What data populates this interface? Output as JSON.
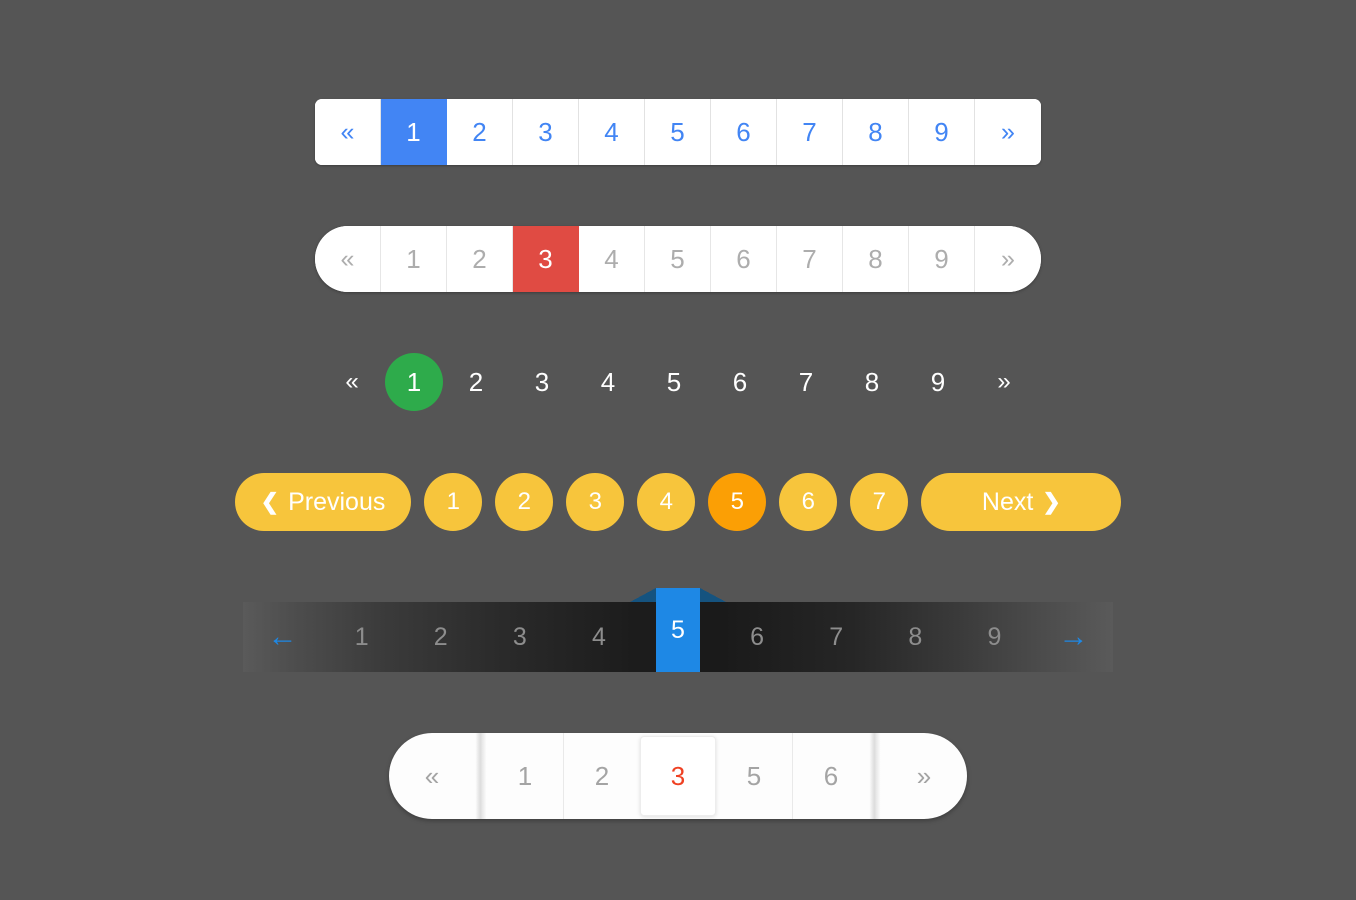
{
  "page": {
    "background_color": "#555555"
  },
  "paginations": [
    {
      "id": "bordered-blue",
      "style": "bordered-square",
      "accent_color": "#4285f4",
      "text_color": "#4285f4",
      "prev_label": "«",
      "next_label": "»",
      "active_page": "1",
      "pages": [
        "1",
        "2",
        "3",
        "4",
        "5",
        "6",
        "7",
        "8",
        "9"
      ]
    },
    {
      "id": "pill-red",
      "style": "rounded-pill",
      "accent_color": "#e04b43",
      "text_color": "#adadad",
      "prev_label": "«",
      "next_label": "»",
      "active_page": "3",
      "pages": [
        "1",
        "2",
        "3",
        "4",
        "5",
        "6",
        "7",
        "8",
        "9"
      ]
    },
    {
      "id": "flat-green",
      "style": "flat-circle",
      "accent_color": "#2eab4b",
      "text_color": "#ffffff",
      "prev_label": "«",
      "next_label": "»",
      "active_page": "1",
      "pages": [
        "1",
        "2",
        "3",
        "4",
        "5",
        "6",
        "7",
        "8",
        "9"
      ]
    },
    {
      "id": "yellow-circles",
      "style": "circle-buttons",
      "accent_color": "#fb9f05",
      "base_color": "#f7c53c",
      "text_color": "#ffffff",
      "prev_label": "Previous",
      "next_label": "Next",
      "prev_icon": "chevron-left-icon",
      "next_icon": "chevron-right-icon",
      "active_page": "5",
      "pages": [
        "1",
        "2",
        "3",
        "4",
        "5",
        "6",
        "7"
      ]
    },
    {
      "id": "dark-gradient",
      "style": "dark-gradient-bar",
      "accent_color": "#1e88e5",
      "text_color": "#8d8d8d",
      "prev_label": "←",
      "next_label": "→",
      "prev_icon": "arrow-left-icon",
      "next_icon": "arrow-right-icon",
      "active_page": "5",
      "pages": [
        "1",
        "2",
        "3",
        "4",
        "5",
        "6",
        "7",
        "8",
        "9"
      ]
    },
    {
      "id": "soft-white",
      "style": "soft-pill-card",
      "accent_color": "#ef4123",
      "text_color": "#a4a4a4",
      "prev_label": "«",
      "next_label": "»",
      "active_page": "3",
      "pages": [
        "1",
        "2",
        "3",
        "5",
        "6"
      ]
    }
  ]
}
